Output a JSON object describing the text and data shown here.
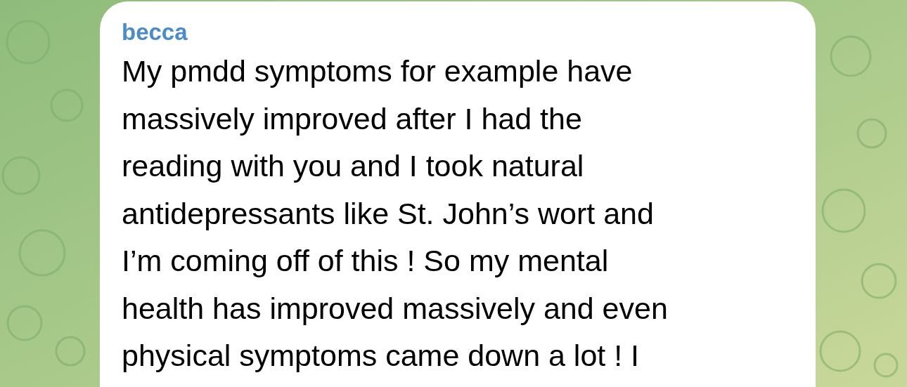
{
  "message": {
    "sender": "becca",
    "lines": [
      "My pmdd symptoms for example have",
      "massively improved after I had the",
      "reading with you and I took natural",
      "antidepressants like St. John’s wort and",
      "I’m coming off of this ! So my mental",
      "health has improved massively and even",
      "physical symptoms came down a lot ! I"
    ]
  }
}
